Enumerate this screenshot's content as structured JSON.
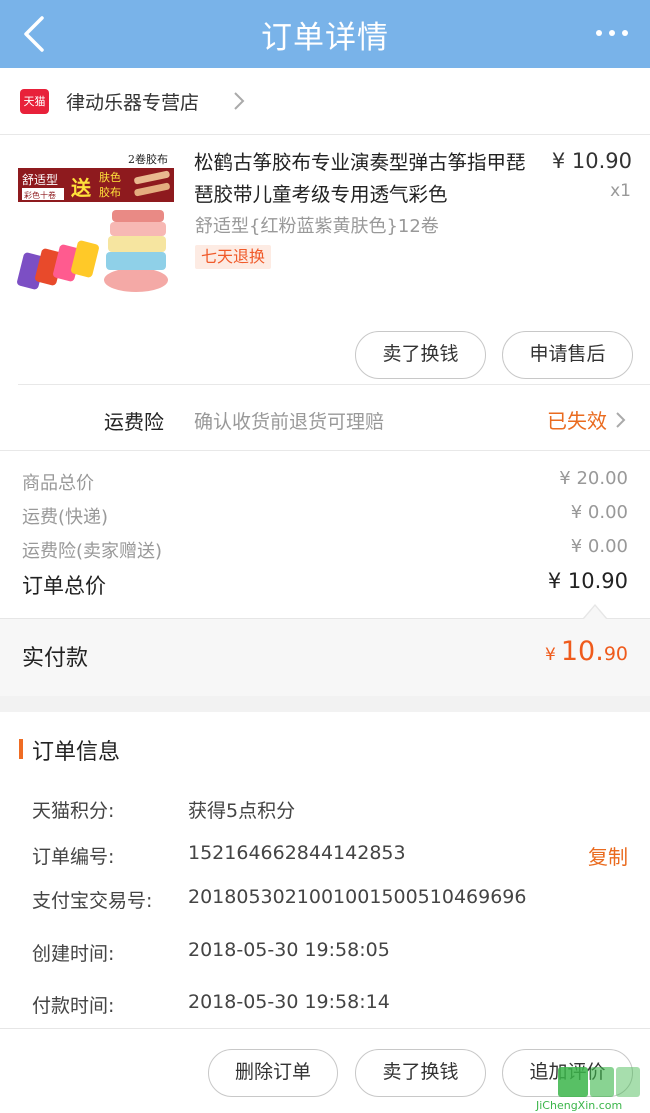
{
  "header": {
    "title": "订单详情"
  },
  "store": {
    "badge": "天猫",
    "name": "律动乐器专营店"
  },
  "product": {
    "title": "松鹤古筝胶布专业演奏型弹古筝指甲琵琶胶带儿童考级专用透气彩色",
    "price": "¥ 10.90",
    "quantity": "x1",
    "spec": "舒适型{红粉蓝紫黄肤色}12卷",
    "tag": "七天退换",
    "image_text": {
      "badge": "2卷胶布",
      "left": "舒适型",
      "left_sub": "彩色十卷",
      "gift": "送",
      "right": "肤色",
      "right2": "胶布"
    },
    "actions": {
      "sell": "卖了换钱",
      "after_sale": "申请售后"
    }
  },
  "insurance": {
    "label": "运费险",
    "desc": "确认收货前退货可理赔",
    "status": "已失效"
  },
  "summary": {
    "rows": [
      {
        "label": "商品总价",
        "value": "¥ 20.00"
      },
      {
        "label": "运费(快递)",
        "value": "¥ 0.00"
      },
      {
        "label": "运费险(卖家赠送)",
        "value": "¥ 0.00"
      }
    ],
    "total_label": "订单总价",
    "total_value": "¥ 10.90",
    "paid_label": "实付款",
    "paid_currency": "¥",
    "paid_int": "10.",
    "paid_dec": "90"
  },
  "order_info": {
    "title": "订单信息",
    "rows": [
      {
        "key": "天猫积分:",
        "value": "获得5点积分"
      },
      {
        "key": "订单编号:",
        "value": "152164662844142853"
      },
      {
        "key": "支付宝交易号:",
        "value": "2018053021001001500510469696"
      },
      {
        "key": "创建时间:",
        "value": "2018-05-30 19:58:05"
      },
      {
        "key": "付款时间:",
        "value": "2018-05-30 19:58:14"
      }
    ],
    "copy_label": "复制"
  },
  "bottom_actions": {
    "delete": "删除订单",
    "sell": "卖了换钱",
    "review": "追加评价"
  },
  "watermark": {
    "text": "JiChengXin.com"
  },
  "colors": {
    "header": "#79b3e9",
    "accent": "#ea6b1f",
    "tmall": "#e8213a"
  }
}
